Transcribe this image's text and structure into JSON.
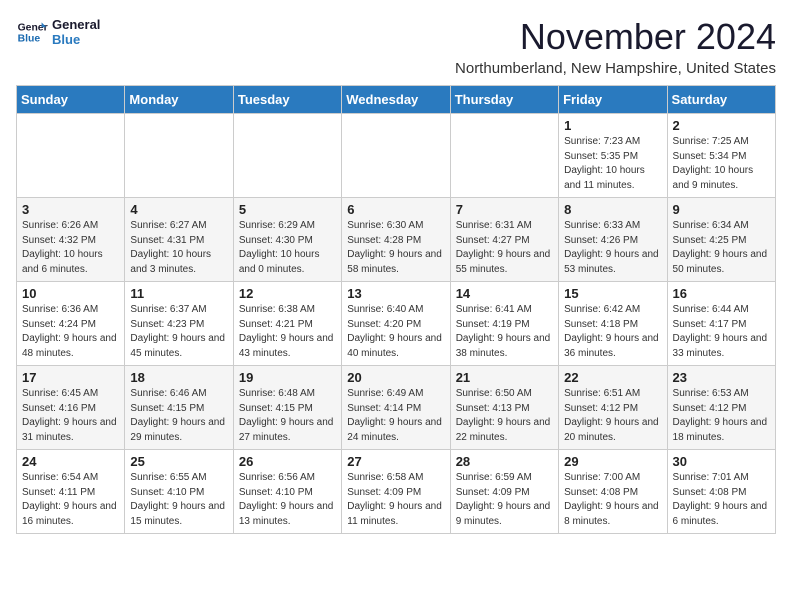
{
  "logo": {
    "line1": "General",
    "line2": "Blue"
  },
  "title": "November 2024",
  "location": "Northumberland, New Hampshire, United States",
  "weekdays": [
    "Sunday",
    "Monday",
    "Tuesday",
    "Wednesday",
    "Thursday",
    "Friday",
    "Saturday"
  ],
  "weeks": [
    [
      {
        "day": "",
        "info": ""
      },
      {
        "day": "",
        "info": ""
      },
      {
        "day": "",
        "info": ""
      },
      {
        "day": "",
        "info": ""
      },
      {
        "day": "",
        "info": ""
      },
      {
        "day": "1",
        "info": "Sunrise: 7:23 AM\nSunset: 5:35 PM\nDaylight: 10 hours and 11 minutes."
      },
      {
        "day": "2",
        "info": "Sunrise: 7:25 AM\nSunset: 5:34 PM\nDaylight: 10 hours and 9 minutes."
      }
    ],
    [
      {
        "day": "3",
        "info": "Sunrise: 6:26 AM\nSunset: 4:32 PM\nDaylight: 10 hours and 6 minutes."
      },
      {
        "day": "4",
        "info": "Sunrise: 6:27 AM\nSunset: 4:31 PM\nDaylight: 10 hours and 3 minutes."
      },
      {
        "day": "5",
        "info": "Sunrise: 6:29 AM\nSunset: 4:30 PM\nDaylight: 10 hours and 0 minutes."
      },
      {
        "day": "6",
        "info": "Sunrise: 6:30 AM\nSunset: 4:28 PM\nDaylight: 9 hours and 58 minutes."
      },
      {
        "day": "7",
        "info": "Sunrise: 6:31 AM\nSunset: 4:27 PM\nDaylight: 9 hours and 55 minutes."
      },
      {
        "day": "8",
        "info": "Sunrise: 6:33 AM\nSunset: 4:26 PM\nDaylight: 9 hours and 53 minutes."
      },
      {
        "day": "9",
        "info": "Sunrise: 6:34 AM\nSunset: 4:25 PM\nDaylight: 9 hours and 50 minutes."
      }
    ],
    [
      {
        "day": "10",
        "info": "Sunrise: 6:36 AM\nSunset: 4:24 PM\nDaylight: 9 hours and 48 minutes."
      },
      {
        "day": "11",
        "info": "Sunrise: 6:37 AM\nSunset: 4:23 PM\nDaylight: 9 hours and 45 minutes."
      },
      {
        "day": "12",
        "info": "Sunrise: 6:38 AM\nSunset: 4:21 PM\nDaylight: 9 hours and 43 minutes."
      },
      {
        "day": "13",
        "info": "Sunrise: 6:40 AM\nSunset: 4:20 PM\nDaylight: 9 hours and 40 minutes."
      },
      {
        "day": "14",
        "info": "Sunrise: 6:41 AM\nSunset: 4:19 PM\nDaylight: 9 hours and 38 minutes."
      },
      {
        "day": "15",
        "info": "Sunrise: 6:42 AM\nSunset: 4:18 PM\nDaylight: 9 hours and 36 minutes."
      },
      {
        "day": "16",
        "info": "Sunrise: 6:44 AM\nSunset: 4:17 PM\nDaylight: 9 hours and 33 minutes."
      }
    ],
    [
      {
        "day": "17",
        "info": "Sunrise: 6:45 AM\nSunset: 4:16 PM\nDaylight: 9 hours and 31 minutes."
      },
      {
        "day": "18",
        "info": "Sunrise: 6:46 AM\nSunset: 4:15 PM\nDaylight: 9 hours and 29 minutes."
      },
      {
        "day": "19",
        "info": "Sunrise: 6:48 AM\nSunset: 4:15 PM\nDaylight: 9 hours and 27 minutes."
      },
      {
        "day": "20",
        "info": "Sunrise: 6:49 AM\nSunset: 4:14 PM\nDaylight: 9 hours and 24 minutes."
      },
      {
        "day": "21",
        "info": "Sunrise: 6:50 AM\nSunset: 4:13 PM\nDaylight: 9 hours and 22 minutes."
      },
      {
        "day": "22",
        "info": "Sunrise: 6:51 AM\nSunset: 4:12 PM\nDaylight: 9 hours and 20 minutes."
      },
      {
        "day": "23",
        "info": "Sunrise: 6:53 AM\nSunset: 4:12 PM\nDaylight: 9 hours and 18 minutes."
      }
    ],
    [
      {
        "day": "24",
        "info": "Sunrise: 6:54 AM\nSunset: 4:11 PM\nDaylight: 9 hours and 16 minutes."
      },
      {
        "day": "25",
        "info": "Sunrise: 6:55 AM\nSunset: 4:10 PM\nDaylight: 9 hours and 15 minutes."
      },
      {
        "day": "26",
        "info": "Sunrise: 6:56 AM\nSunset: 4:10 PM\nDaylight: 9 hours and 13 minutes."
      },
      {
        "day": "27",
        "info": "Sunrise: 6:58 AM\nSunset: 4:09 PM\nDaylight: 9 hours and 11 minutes."
      },
      {
        "day": "28",
        "info": "Sunrise: 6:59 AM\nSunset: 4:09 PM\nDaylight: 9 hours and 9 minutes."
      },
      {
        "day": "29",
        "info": "Sunrise: 7:00 AM\nSunset: 4:08 PM\nDaylight: 9 hours and 8 minutes."
      },
      {
        "day": "30",
        "info": "Sunrise: 7:01 AM\nSunset: 4:08 PM\nDaylight: 9 hours and 6 minutes."
      }
    ]
  ]
}
